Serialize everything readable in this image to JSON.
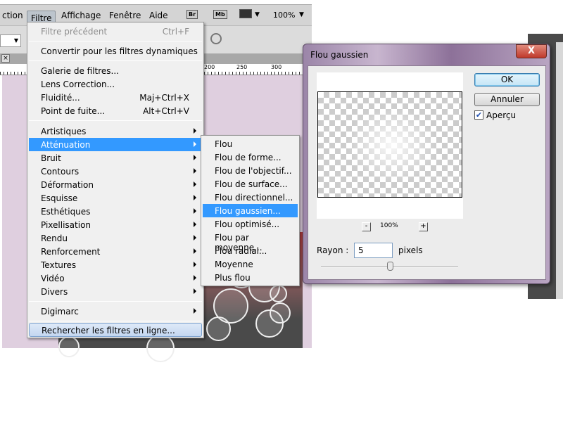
{
  "menubar": {
    "items": [
      "ction",
      "Filtre",
      "Affichage",
      "Fenêtre",
      "Aide"
    ],
    "icons": [
      "Br",
      "Mb"
    ],
    "zoom": "100%"
  },
  "ruler": {
    "labels": [
      "200",
      "250",
      "300"
    ]
  },
  "filter_menu": {
    "items": [
      {
        "label": "Filtre précédent",
        "shortcut": "Ctrl+F",
        "disabled": true
      },
      {
        "label": "Convertir pour les filtres dynamiques"
      },
      {
        "label": "Galerie de filtres..."
      },
      {
        "label": "Lens Correction..."
      },
      {
        "label": "Fluidité...",
        "shortcut": "Maj+Ctrl+X"
      },
      {
        "label": "Point de fuite...",
        "shortcut": "Alt+Ctrl+V"
      },
      {
        "label": "Artistiques",
        "submenu": true
      },
      {
        "label": "Atténuation",
        "submenu": true,
        "selected": true
      },
      {
        "label": "Bruit",
        "submenu": true
      },
      {
        "label": "Contours",
        "submenu": true
      },
      {
        "label": "Déformation",
        "submenu": true
      },
      {
        "label": "Esquisse",
        "submenu": true
      },
      {
        "label": "Esthétiques",
        "submenu": true
      },
      {
        "label": "Pixellisation",
        "submenu": true
      },
      {
        "label": "Rendu",
        "submenu": true
      },
      {
        "label": "Renforcement",
        "submenu": true
      },
      {
        "label": "Textures",
        "submenu": true
      },
      {
        "label": "Vidéo",
        "submenu": true
      },
      {
        "label": "Divers",
        "submenu": true
      },
      {
        "label": "Digimarc",
        "submenu": true
      },
      {
        "label": "Rechercher les filtres en ligne..."
      }
    ]
  },
  "blur_submenu": {
    "items": [
      "Flou",
      "Flou de forme...",
      "Flou de l'objectif...",
      "Flou de surface...",
      "Flou directionnel...",
      "Flou gaussien...",
      "Flou optimisé...",
      "Flou par moyenne...",
      "Flou radial...",
      "Moyenne",
      "Plus flou"
    ],
    "selected": "Flou gaussien..."
  },
  "dialog": {
    "title": "Flou gaussien",
    "ok": "OK",
    "cancel": "Annuler",
    "preview_label": "Aperçu",
    "preview_checked": true,
    "zoom": "100%",
    "zoom_out": "-",
    "zoom_in": "+",
    "radius_label": "Rayon :",
    "radius_value": "5",
    "radius_unit": "pixels",
    "close": "X"
  },
  "colors": {
    "highlight": "#3399ff",
    "canvas": "#dfcfdf",
    "dialog_frame": "#9b85a8"
  }
}
